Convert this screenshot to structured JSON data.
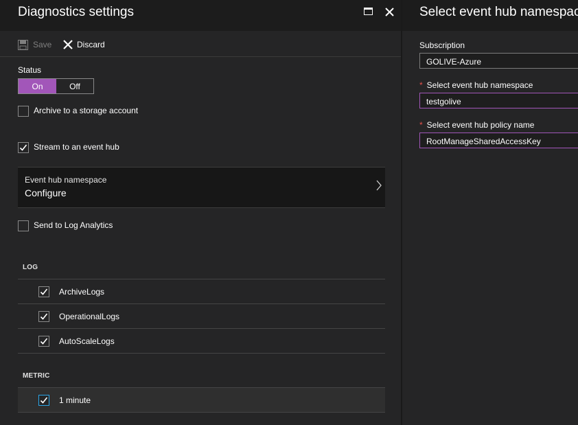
{
  "left_blade": {
    "title": "Diagnostics settings",
    "toolbar": {
      "save_label": "Save",
      "discard_label": "Discard"
    },
    "status": {
      "label": "Status",
      "on_label": "On",
      "off_label": "Off",
      "selected": "On"
    },
    "options": {
      "archive": {
        "label": "Archive to a storage account",
        "checked": false
      },
      "stream": {
        "label": "Stream to an event hub",
        "checked": true
      },
      "log_analytics": {
        "label": "Send to Log Analytics",
        "checked": false
      }
    },
    "event_hub": {
      "label": "Event hub namespace",
      "value": "Configure"
    },
    "log": {
      "title": "LOG",
      "items": [
        {
          "label": "ArchiveLogs",
          "checked": true
        },
        {
          "label": "OperationalLogs",
          "checked": true
        },
        {
          "label": "AutoScaleLogs",
          "checked": true
        }
      ]
    },
    "metric": {
      "title": "METRIC",
      "items": [
        {
          "label": "1 minute",
          "checked": true
        }
      ]
    }
  },
  "right_blade": {
    "title": "Select event hub namespace",
    "subscription": {
      "label": "Subscription",
      "value": "GOLIVE-Azure"
    },
    "namespace": {
      "required_mark": "*",
      "label": "Select event hub namespace",
      "value": "testgolive"
    },
    "policy": {
      "required_mark": "*",
      "label": "Select event hub policy name",
      "value": "RootManageSharedAccessKey"
    }
  },
  "colors": {
    "accent_purple": "#a256b9",
    "focus_blue": "#2ba6e8",
    "required_red": "#e5504a",
    "background": "#252526",
    "header": "#1c1c1c"
  }
}
